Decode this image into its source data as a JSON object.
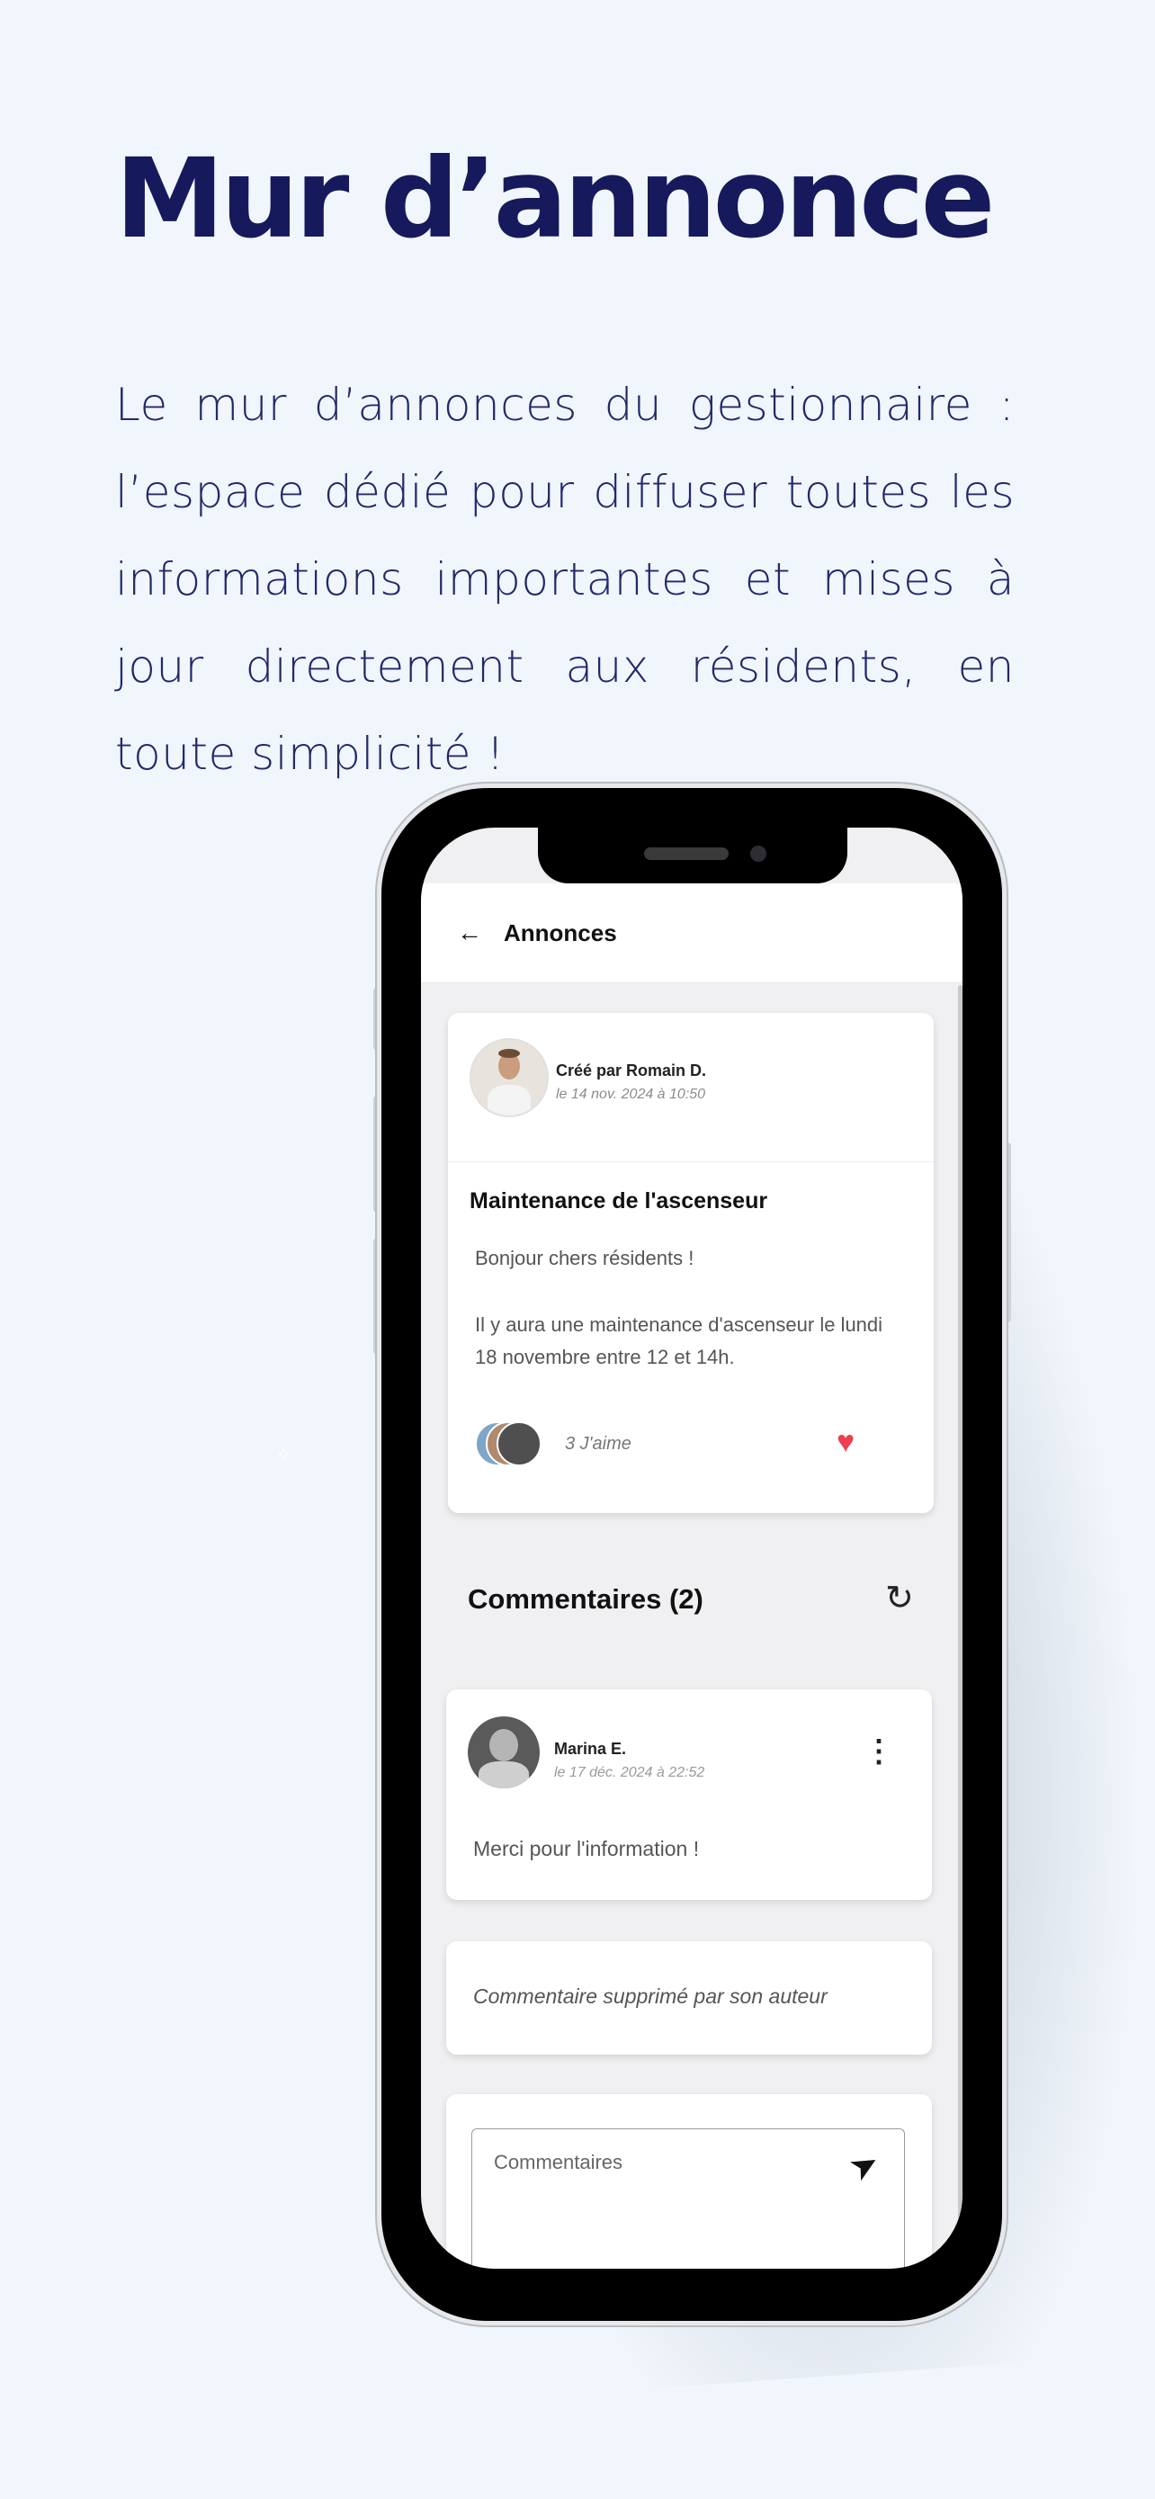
{
  "hero": {
    "title": "Mur d’annonce",
    "description": "Le mur d’annonces du gestionnaire : l’espace dédié pour diffuser toutes les informations importantes et mises à jour directement aux résidents, en toute simplicité !"
  },
  "appbar": {
    "back_icon": "arrow-left-icon",
    "title": "Annonces"
  },
  "post": {
    "author_label": "Créé par Romain D.",
    "date": "le 14 nov. 2024 à 10:50",
    "title": "Maintenance de l'ascenseur",
    "body": [
      "Bonjour chers résidents !",
      "Il y aura une maintenance d'ascenseur le lundi 18 novembre entre 12 et 14h."
    ],
    "likes_label": "3 J'aime",
    "liked": true
  },
  "comments": {
    "title": "Commentaires (2)",
    "items": [
      {
        "author": "Marina E.",
        "date": "le 17 déc. 2024 à 22:52",
        "text": "Merci pour l'information !"
      },
      {
        "text": "Commentaire supprimé par son auteur"
      }
    ]
  },
  "composer": {
    "placeholder": "Commentaires"
  },
  "colors": {
    "background": "#f1f6fc",
    "headline": "#16195c",
    "heart": "#ee3e52"
  }
}
